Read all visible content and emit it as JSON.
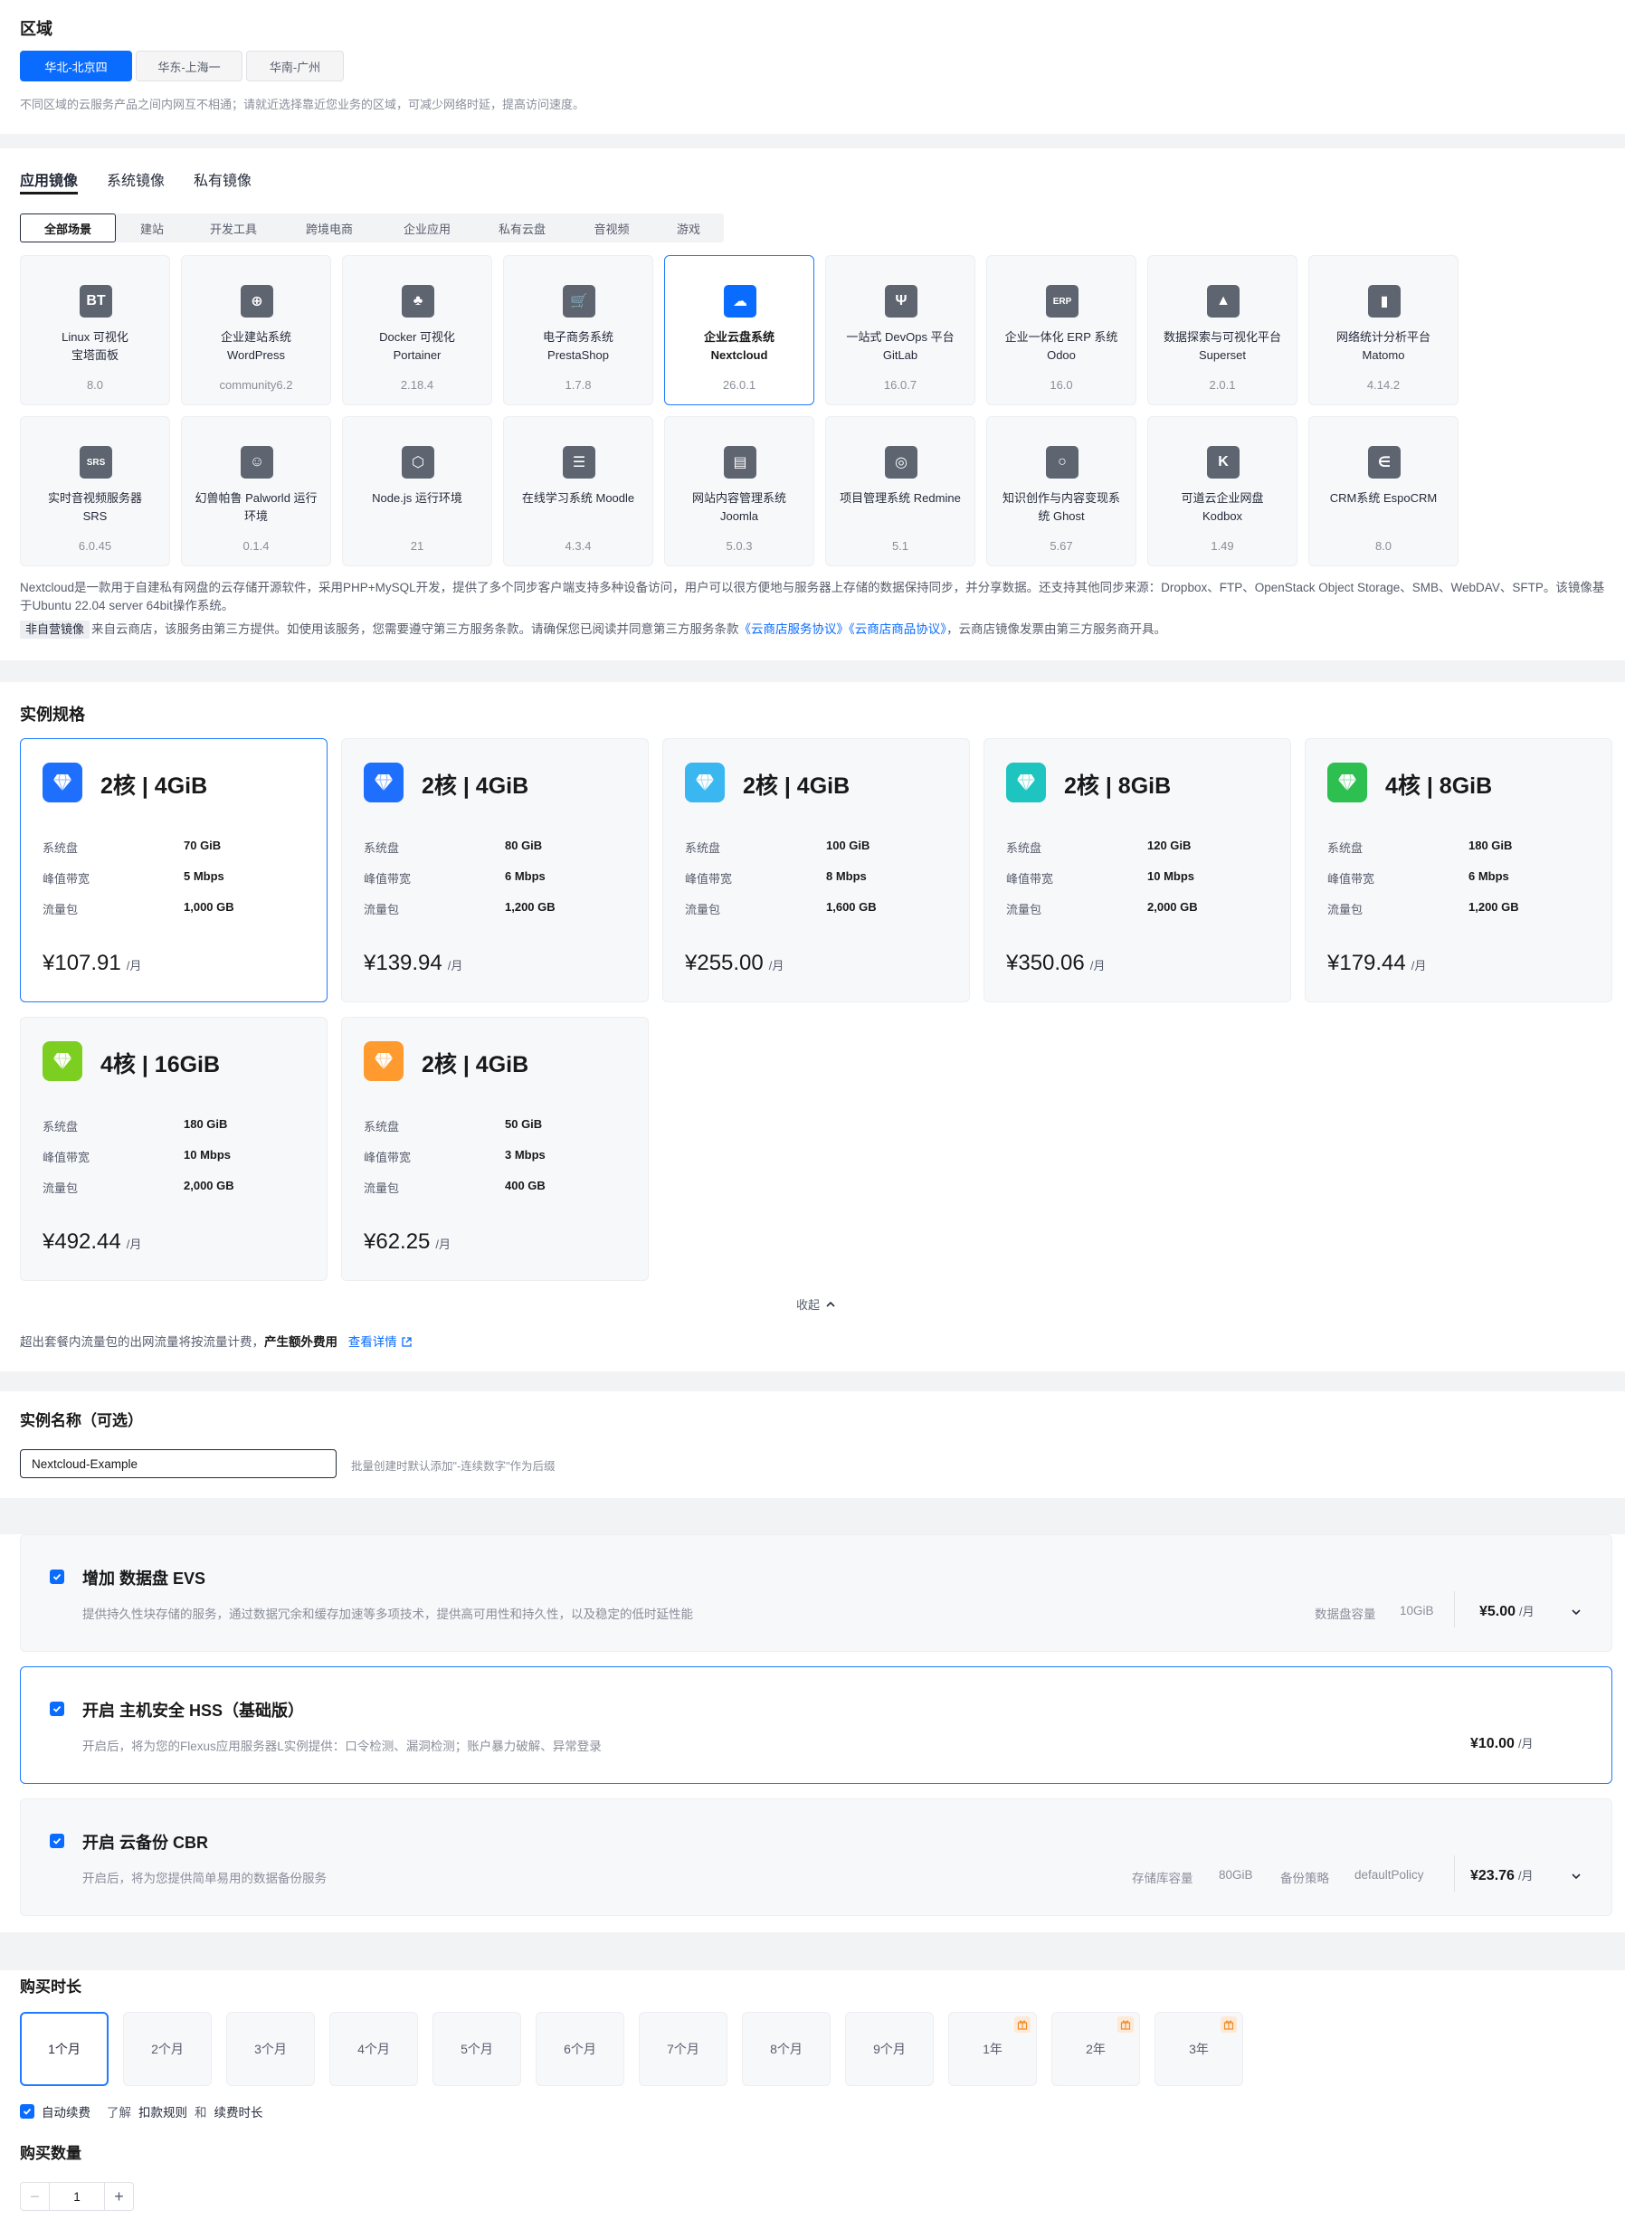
{
  "region": {
    "title": "区域",
    "options": [
      "华北-北京四",
      "华东-上海一",
      "华南-广州"
    ],
    "selected": "华北-北京四",
    "note": "不同区域的云服务产品之间内网互不相通；请就近选择靠近您业务的区域，可减少网络时延，提高访问速度。"
  },
  "image": {
    "tabs": [
      "应用镜像",
      "系统镜像",
      "私有镜像"
    ],
    "active_tab": "应用镜像",
    "categories": [
      "全部场景",
      "建站",
      "开发工具",
      "跨境电商",
      "企业应用",
      "私有云盘",
      "音视频",
      "游戏"
    ],
    "active_category": "全部场景",
    "cards": [
      {
        "line1": "Linux 可视化",
        "line2": "宝塔面板",
        "version": "8.0",
        "icon": "bt-logo-icon",
        "glyph": "BT"
      },
      {
        "line1": "企业建站系统",
        "line2": "WordPress",
        "version": "community6.2",
        "icon": "wordpress-icon",
        "glyph": "⊕"
      },
      {
        "line1": "Docker 可视化",
        "line2": "Portainer",
        "version": "2.18.4",
        "icon": "portainer-icon",
        "glyph": "♣"
      },
      {
        "line1": "电子商务系统",
        "line2": "PrestaShop",
        "version": "1.7.8",
        "icon": "cart-icon",
        "glyph": "🛒"
      },
      {
        "line1": "企业云盘系统",
        "line2": "Nextcloud",
        "version": "26.0.1",
        "icon": "cloud-icon",
        "glyph": "☁",
        "selected": true
      },
      {
        "line1": "一站式 DevOps 平台",
        "line2": "GitLab",
        "version": "16.0.7",
        "icon": "git-branch-icon",
        "glyph": "Ψ"
      },
      {
        "line1": "企业一体化 ERP 系统",
        "line2": "Odoo",
        "version": "16.0",
        "icon": "erp-icon",
        "glyph": "ERP"
      },
      {
        "line1": "数据探索与可视化平台",
        "line2": "Superset",
        "version": "2.0.1",
        "icon": "chart-icon",
        "glyph": "▲"
      },
      {
        "line1": "网络统计分析平台",
        "line2": "Matomo",
        "version": "4.14.2",
        "icon": "bar-chart-icon",
        "glyph": "▮"
      },
      {
        "line1": "实时音视频服务器",
        "line2": "SRS",
        "version": "6.0.45",
        "icon": "srs-icon",
        "glyph": "SRS"
      },
      {
        "line1": "幻兽帕鲁 Palworld 运行",
        "line2": "环境",
        "version": "0.1.4",
        "icon": "palworld-icon",
        "glyph": "☺"
      },
      {
        "line1": "Node.js 运行环境",
        "line2": "",
        "version": "21",
        "icon": "nodejs-icon",
        "glyph": "⬡"
      },
      {
        "line1": "在线学习系统 Moodle",
        "line2": "",
        "version": "4.3.4",
        "icon": "moodle-icon",
        "glyph": "☰"
      },
      {
        "line1": "网站内容管理系统",
        "line2": "Joomla",
        "version": "5.0.3",
        "icon": "joomla-icon",
        "glyph": "▤"
      },
      {
        "line1": "项目管理系统 Redmine",
        "line2": "",
        "version": "5.1",
        "icon": "redmine-icon",
        "glyph": "◎"
      },
      {
        "line1": "知识创作与内容变现系",
        "line2": "统 Ghost",
        "version": "5.67",
        "icon": "ghost-icon",
        "glyph": "○"
      },
      {
        "line1": "可道云企业网盘",
        "line2": "Kodbox",
        "version": "1.49",
        "icon": "kodbox-icon",
        "glyph": "K"
      },
      {
        "line1": "CRM系统 EspoCRM",
        "line2": "",
        "version": "8.0",
        "icon": "espocrm-icon",
        "glyph": "∈"
      }
    ],
    "description": "Nextcloud是一款用于自建私有网盘的云存储开源软件，采用PHP+MySQL开发，提供了多个同步客户端支持多种设备访问，用户可以很方便地与服务器上存储的数据保持同步，并分享数据。还支持其他同步来源：Dropbox、FTP、OpenStack Object Storage、SMB、WebDAV、SFTP。该镜像基于Ubuntu 22.04 server 64bit操作系统。",
    "third_party_tag": "非自营镜像",
    "third_party_text": "来自云商店，该服务由第三方提供。如使用该服务，您需要遵守第三方服务条款。请确保您已阅读并同意第三方服务条款",
    "agreement1": "《云商店服务协议》",
    "agreement2": "《云商店商品协议》",
    "third_party_tail": "，云商店镜像发票由第三方服务商开具。"
  },
  "spec": {
    "title": "实例规格",
    "labels": {
      "disk": "系统盘",
      "bandwidth": "峰值带宽",
      "traffic": "流量包",
      "unit": "/月"
    },
    "cards": [
      {
        "title": "2核 | 4GiB",
        "disk": "70 GiB",
        "bandwidth": "5 Mbps",
        "traffic": "1,000 GB",
        "price": "¥107.91",
        "color": "#1f6fff",
        "selected": true
      },
      {
        "title": "2核 | 4GiB",
        "disk": "80 GiB",
        "bandwidth": "6 Mbps",
        "traffic": "1,200 GB",
        "price": "¥139.94",
        "color": "#1f6fff"
      },
      {
        "title": "2核 | 4GiB",
        "disk": "100 GiB",
        "bandwidth": "8 Mbps",
        "traffic": "1,600 GB",
        "price": "¥255.00",
        "color": "#3ab6f0"
      },
      {
        "title": "2核 | 8GiB",
        "disk": "120 GiB",
        "bandwidth": "10 Mbps",
        "traffic": "2,000 GB",
        "price": "¥350.06",
        "color": "#1ec4c0"
      },
      {
        "title": "4核 | 8GiB",
        "disk": "180 GiB",
        "bandwidth": "6 Mbps",
        "traffic": "1,200 GB",
        "price": "¥179.44",
        "color": "#2dbf4f"
      },
      {
        "title": "4核 | 16GiB",
        "disk": "180 GiB",
        "bandwidth": "10 Mbps",
        "traffic": "2,000 GB",
        "price": "¥492.44",
        "color": "#7ccf20"
      },
      {
        "title": "2核 | 4GiB",
        "disk": "50 GiB",
        "bandwidth": "3 Mbps",
        "traffic": "400 GB",
        "price": "¥62.25",
        "color": "#ff9a2e"
      }
    ],
    "collapse": "收起",
    "note_prefix": "超出套餐内流量包的出网流量将按流量计费，",
    "note_bold": "产生额外费用",
    "note_link": "查看详情"
  },
  "name": {
    "title": "实例名称（可选）",
    "value": "Nextcloud-Example",
    "hint": "批量创建时默认添加\"-连续数字\"作为后缀"
  },
  "addons": [
    {
      "title": "增加 数据盘 EVS",
      "desc": "提供持久性块存储的服务，通过数据冗余和缓存加速等多项技术，提供高可用性和持久性，以及稳定的低时延性能",
      "meta1_label": "数据盘容量",
      "meta1_value": "10GiB",
      "price": "¥5.00",
      "unit": "/月"
    },
    {
      "title": "开启 主机安全 HSS（基础版）",
      "desc": "开启后，将为您的Flexus应用服务器L实例提供：口令检测、漏洞检测；账户暴力破解、异常登录",
      "price": "¥10.00",
      "unit": "/月"
    },
    {
      "title": "开启 云备份 CBR",
      "desc": "开启后，将为您提供简单易用的数据备份服务",
      "meta1_label": "存储库容量",
      "meta1_value": "80GiB",
      "meta2_label": "备份策略",
      "meta2_value": "defaultPolicy",
      "price": "¥23.76",
      "unit": "/月"
    }
  ],
  "duration": {
    "title": "购买时长",
    "options": [
      "1个月",
      "2个月",
      "3个月",
      "4个月",
      "5个月",
      "6个月",
      "7个月",
      "8个月",
      "9个月",
      "1年",
      "2年",
      "3年"
    ],
    "selected": "1个月",
    "auto_renew": "自动续费",
    "learn": "了解",
    "rule1": "扣款规则",
    "and": "和",
    "rule2": "续费时长"
  },
  "quantity": {
    "title": "购买数量",
    "value": "1",
    "minus": "−",
    "plus": "+"
  },
  "colors": {
    "accent": "#0a6cff",
    "selected_border": "#1f7bff"
  }
}
